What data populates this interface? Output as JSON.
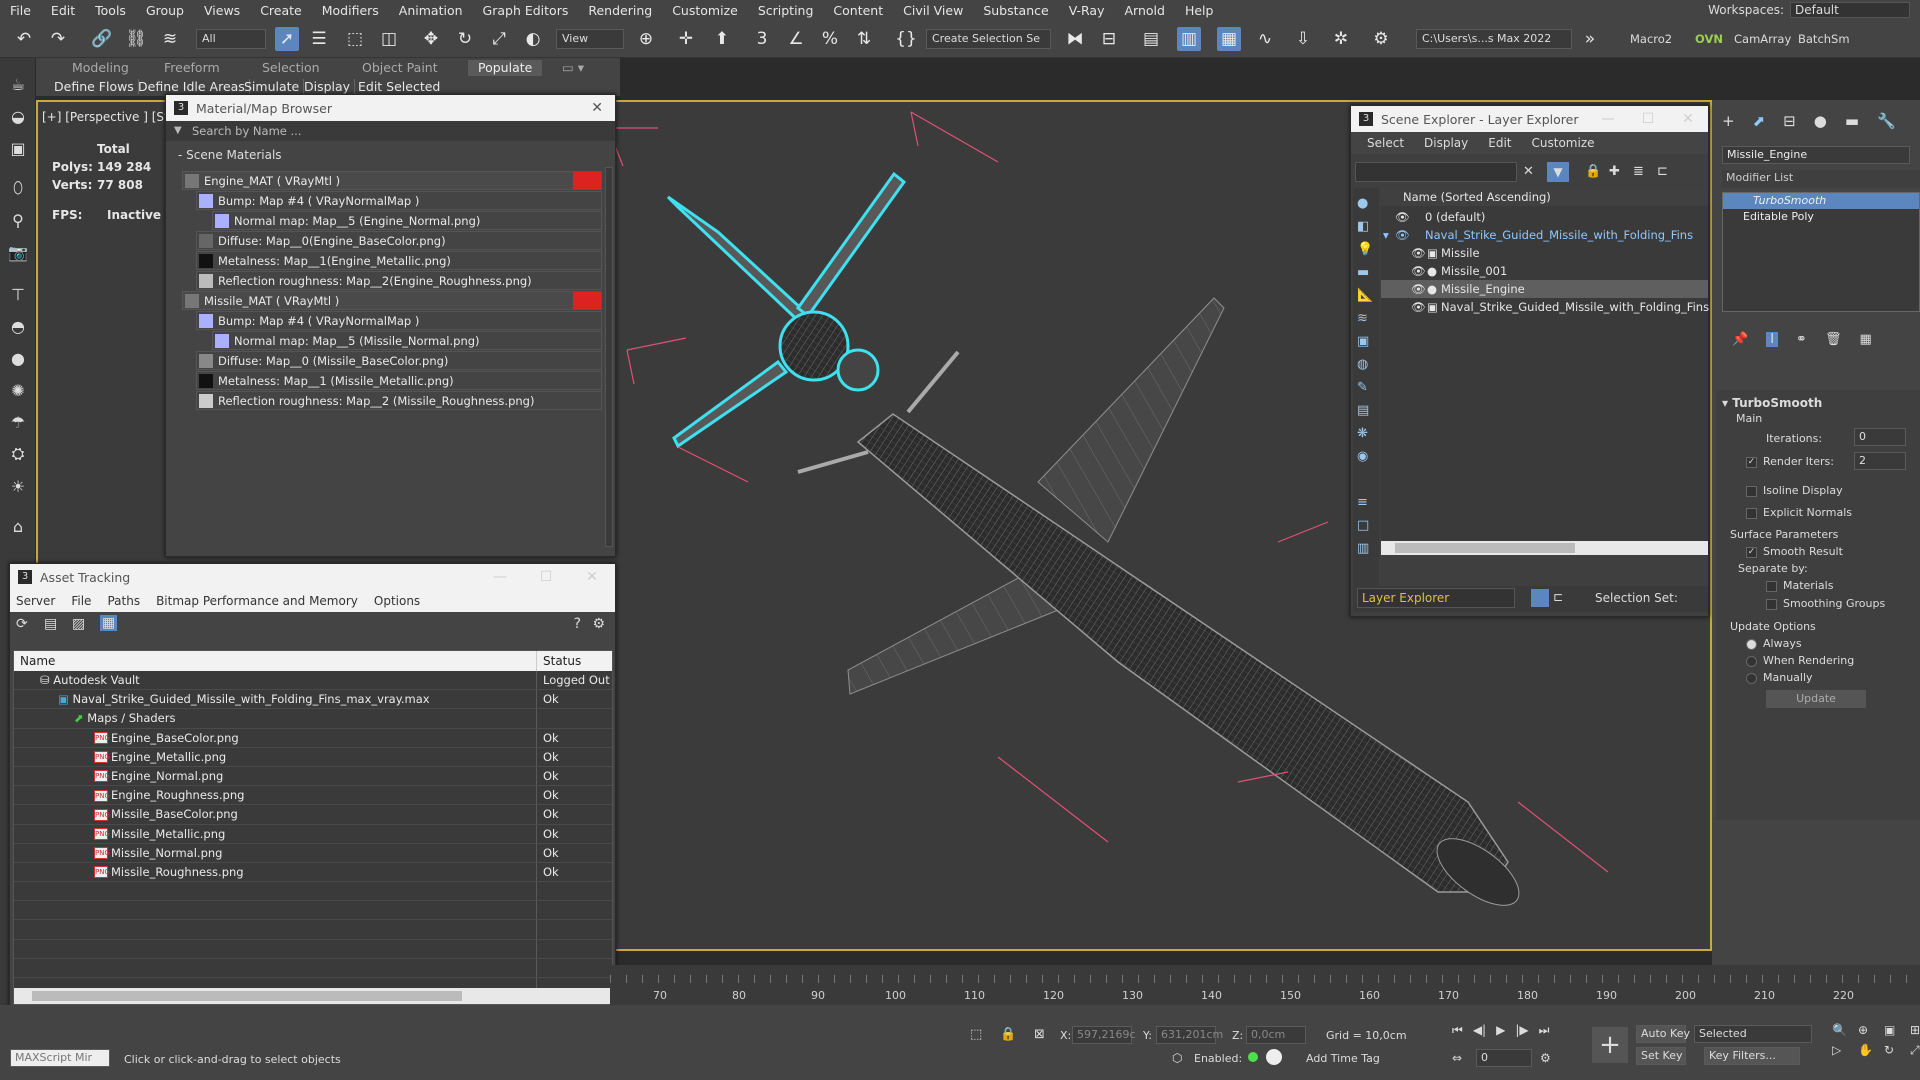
{
  "menubar": {
    "items": [
      "File",
      "Edit",
      "Tools",
      "Group",
      "Views",
      "Create",
      "Modifiers",
      "Animation",
      "Graph Editors",
      "Rendering",
      "Customize",
      "Scripting",
      "Content",
      "Civil View",
      "Substance",
      "V-Ray",
      "Arnold",
      "Help"
    ],
    "workspaces_label": "Workspaces:",
    "workspaces_value": "Default"
  },
  "toolbar": {
    "filter_value": "All",
    "view_value": "View",
    "create_selection_set": "Create Selection Se",
    "project_path": "C:\\Users\\s...s Max 2022",
    "macro": "Macro2",
    "ovn": "OVN",
    "camarray": "CamArray",
    "batchsm": "BatchSm"
  },
  "ribbon": {
    "tabs": [
      "Modeling",
      "Freeform",
      "Selection",
      "Object Paint",
      "Populate"
    ],
    "active_tab": "Populate",
    "sub_items": [
      "Define Flows",
      "Define Idle Areas",
      "Simulate",
      "Display",
      "Edit Selected"
    ]
  },
  "viewport": {
    "label": "[+] [Perspective ] [St",
    "stats": {
      "total_label": "Total",
      "polys_label": "Polys:",
      "polys": "149 284",
      "verts_label": "Verts:",
      "verts": "77 808",
      "fps_label": "FPS:",
      "fps": "Inactive"
    },
    "wire_color": "#9a9a9a",
    "select_color": "#3fe0f0",
    "bbox_color": "#e0507a"
  },
  "material_browser": {
    "title": "Material/Map Browser",
    "search_placeholder": "Search by Name ...",
    "section": "- Scene Materials",
    "rows": [
      "Engine_MAT  ( VRayMtl )",
      "Bump: Map #4  ( VRayNormalMap )",
      "Normal map: Map__5 (Engine_Normal.png)",
      "Diffuse: Map__0(Engine_BaseColor.png)",
      "Metalness: Map__1(Engine_Metallic.png)",
      "Reflection roughness: Map__2(Engine_Roughness.png)",
      "Missile_MAT  ( VRayMtl )",
      "Bump: Map #4  ( VRayNormalMap )",
      "Normal map: Map__5 (Missile_Normal.png)",
      "Diffuse: Map__0 (Missile_BaseColor.png)",
      "Metalness: Map__1 (Missile_Metallic.png)",
      "Reflection roughness: Map__2 (Missile_Roughness.png)"
    ]
  },
  "asset_tracking": {
    "title": "Asset Tracking",
    "menu": [
      "Server",
      "File",
      "Paths",
      "Bitmap Performance and Memory",
      "Options"
    ],
    "col_name": "Name",
    "col_status": "Status",
    "rows": [
      {
        "name": "Autodesk Vault",
        "status": "Logged Out"
      },
      {
        "name": "Naval_Strike_Guided_Missile_with_Folding_Fins_max_vray.max",
        "status": "Ok"
      },
      {
        "name": "Maps / Shaders",
        "status": ""
      },
      {
        "name": "Engine_BaseColor.png",
        "status": "Ok"
      },
      {
        "name": "Engine_Metallic.png",
        "status": "Ok"
      },
      {
        "name": "Engine_Normal.png",
        "status": "Ok"
      },
      {
        "name": "Engine_Roughness.png",
        "status": "Ok"
      },
      {
        "name": "Missile_BaseColor.png",
        "status": "Ok"
      },
      {
        "name": "Missile_Metallic.png",
        "status": "Ok"
      },
      {
        "name": "Missile_Normal.png",
        "status": "Ok"
      },
      {
        "name": "Missile_Roughness.png",
        "status": "Ok"
      }
    ]
  },
  "scene_explorer": {
    "title": "Scene Explorer - Layer Explorer",
    "menu": [
      "Select",
      "Display",
      "Edit",
      "Customize"
    ],
    "col_header": "Name (Sorted Ascending)",
    "rows": [
      "0 (default)",
      "Naval_Strike_Guided_Missile_with_Folding_Fins",
      "Missile",
      "Missile_001",
      "Missile_Engine",
      "Naval_Strike_Guided_Missile_with_Folding_Fins"
    ],
    "footer_layer": "Layer Explorer",
    "footer_selset": "Selection Set:"
  },
  "modify_panel": {
    "object_name": "Missile_Engine",
    "modifier_list": "Modifier List",
    "stack": [
      "TurboSmooth",
      "Editable Poly"
    ],
    "rollout": "TurboSmooth",
    "main": "Main",
    "iterations_label": "Iterations:",
    "iterations": "0",
    "render_iters_label": "Render Iters:",
    "render_iters": "2",
    "isoline": "Isoline Display",
    "explicit": "Explicit Normals",
    "surface_params": "Surface Parameters",
    "smooth_result": "Smooth Result",
    "separate_by": "Separate by:",
    "materials": "Materials",
    "smoothing_groups": "Smoothing Groups",
    "update_options": "Update Options",
    "always": "Always",
    "when_rendering": "When Rendering",
    "manually": "Manually",
    "update_btn": "Update"
  },
  "timeline": {
    "ticks": [
      "70",
      "80",
      "90",
      "100",
      "110",
      "120",
      "130",
      "140",
      "150",
      "160",
      "170",
      "180",
      "190",
      "200",
      "210",
      "220"
    ]
  },
  "statusbar": {
    "maxscript": "MAXScript Mir",
    "prompt": "Click or click-and-drag to select objects",
    "x_label": "X:",
    "x": "597,2169c",
    "y_label": "Y:",
    "y": "631,201cm",
    "z_label": "Z:",
    "z": "0,0cm",
    "grid": "Grid = 10,0cm",
    "enabled": "Enabled:",
    "add_time_tag": "Add Time Tag",
    "auto_key": "Auto Key",
    "set_key": "Set Key",
    "selected": "Selected",
    "key_filters": "Key Filters...",
    "frame": "0"
  }
}
